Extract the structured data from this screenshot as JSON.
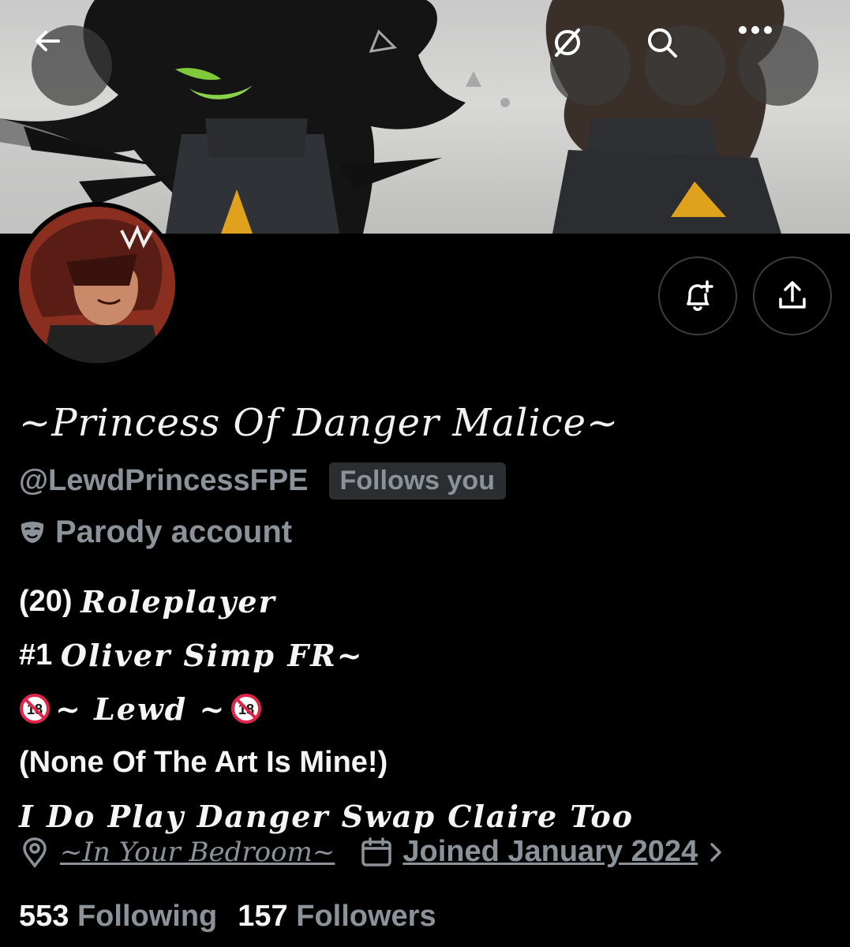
{
  "header": {
    "back_icon": "arrow-left-icon",
    "grok_icon": "grok-icon",
    "search_icon": "search-icon",
    "more_icon": "more-horizontal-icon"
  },
  "profile": {
    "display_name": "~Princess Of Danger Malice~",
    "handle": "@LewdPrincessFPE",
    "follows_badge": "Follows you",
    "parody_label": "Parody account",
    "parody_icon": "mask-icon",
    "bio": {
      "line1_prefix": "(20)",
      "line1_script": "Roleplayer",
      "line2_prefix": "#1",
      "line2_script": "Oliver Simp FR~",
      "line3_script": "~ Lewd ~",
      "line4": "(None Of The Art Is Mine!)",
      "line5_script": "I Do Play Danger Swap Claire Too"
    },
    "location": "~In Your Bedroom~",
    "joined": "Joined January 2024"
  },
  "stats": {
    "following_count": "553",
    "following_label": "Following",
    "followers_count": "157",
    "followers_label": "Followers"
  },
  "colors": {
    "background": "#000000",
    "text_primary": "#e7e9ea",
    "text_secondary": "#8b9299",
    "badge_bg": "#2a2e31"
  }
}
